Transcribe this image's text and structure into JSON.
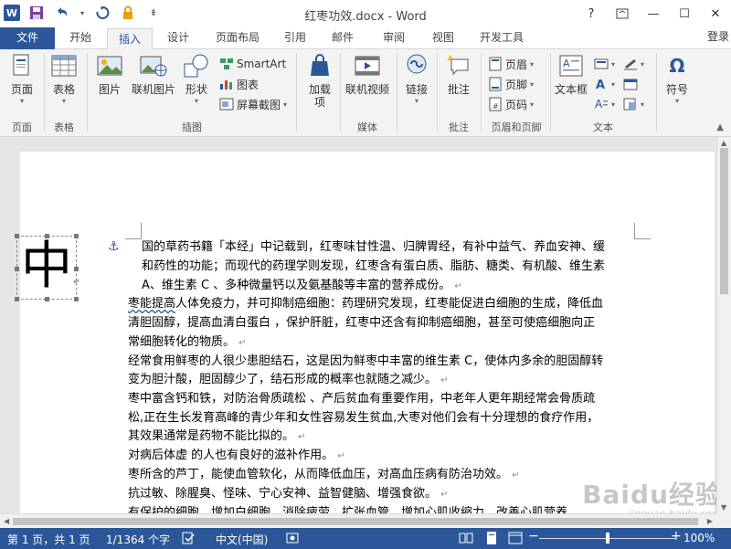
{
  "window": {
    "title": "红枣功效.docx - Word",
    "app_icon_letter": "W",
    "controls": [
      "?",
      "—",
      "☐",
      "✕"
    ],
    "ribbon_display_icon": "ribbon-display-options-icon"
  },
  "tabs": [
    "文件",
    "开始",
    "插入",
    "设计",
    "页面布局",
    "引用",
    "邮件",
    "审阅",
    "视图",
    "开发工具"
  ],
  "active_tab": "插入",
  "account": "登录",
  "ribbon": {
    "groups": {
      "pages": "页面",
      "tables": "表格",
      "illustrations": "插图",
      "media": "媒体",
      "comments": "批注",
      "header_footer": "页眉和页脚",
      "text": "文本"
    },
    "buttons": {
      "pages": "页面",
      "table": "表格",
      "pictures": "图片",
      "online_pictures": "联机图片",
      "shapes": "形状",
      "smartart": "SmartArt",
      "chart": "图表",
      "screenshot": "屏幕截图",
      "addins": "加载",
      "addins_line2": "项",
      "online_video": "联机视频",
      "link": "链接",
      "comment": "批注",
      "header": "页眉",
      "footer": "页脚",
      "page_number": "页码",
      "textbox": "文本框",
      "symbol": "符号"
    }
  },
  "document": {
    "drop_cap": "中",
    "lines": [
      "国的草药书籍「本经」中记载到，红枣味甘性温、归脾胃经，有补中益气、养血安神、缓",
      "和药性的功能；而现代的药理学则发现，红枣含有蛋白质、脂肪、糖类、有机酸、维生素",
      "A、维生素 C 、多种微量钙以及氨基酸等丰富的营养成份。",
      "枣能提高人体免疫力，并可抑制癌细胞：药理研究发现，红枣能促进白细胞的生成，降低血",
      "清胆固醇，提高血清白蛋白 ，保护肝脏，红枣中还含有抑制癌细胞，甚至可使癌细胞向正",
      "常细胞转化的物质。",
      "经常食用鲜枣的人很少患胆结石，这是因为鲜枣中丰富的维生素 C，使体内多余的胆固醇转",
      "变为胆汁酸，胆固醇少了，结石形成的概率也就随之减少。",
      "枣中富含钙和铁，对防治骨质疏松 、产后贫血有重要作用，中老年人更年期经常会骨质疏",
      "松,正在生长发育高峰的青少年和女性容易发生贫血,大枣对他们会有十分理想的食疗作用，",
      "其效果通常是药物不能比拟的。",
      "对病后体虚 的人也有良好的滋补作用。",
      "枣所含的芦丁，能使血管软化，从而降低血压，对高血压病有防治功效。",
      "抗过敏、除腥臭、怪味、宁心安神、益智健脑、增强食欲。",
      "有保护的细胞、增加白细胞、消除疲劳、扩张血管、增加心肌收缩力，改善心肌营养"
    ]
  },
  "status": {
    "page": "第 1 页，共 1 页",
    "words": "1/1364 个字",
    "language": "中文(中国)",
    "zoom": "100%",
    "zoom_minus": "−",
    "zoom_plus": "+",
    "zoom_level": 0.5
  },
  "watermark": {
    "text": "Baidu经验",
    "url": "jingyan.baidu.com"
  }
}
